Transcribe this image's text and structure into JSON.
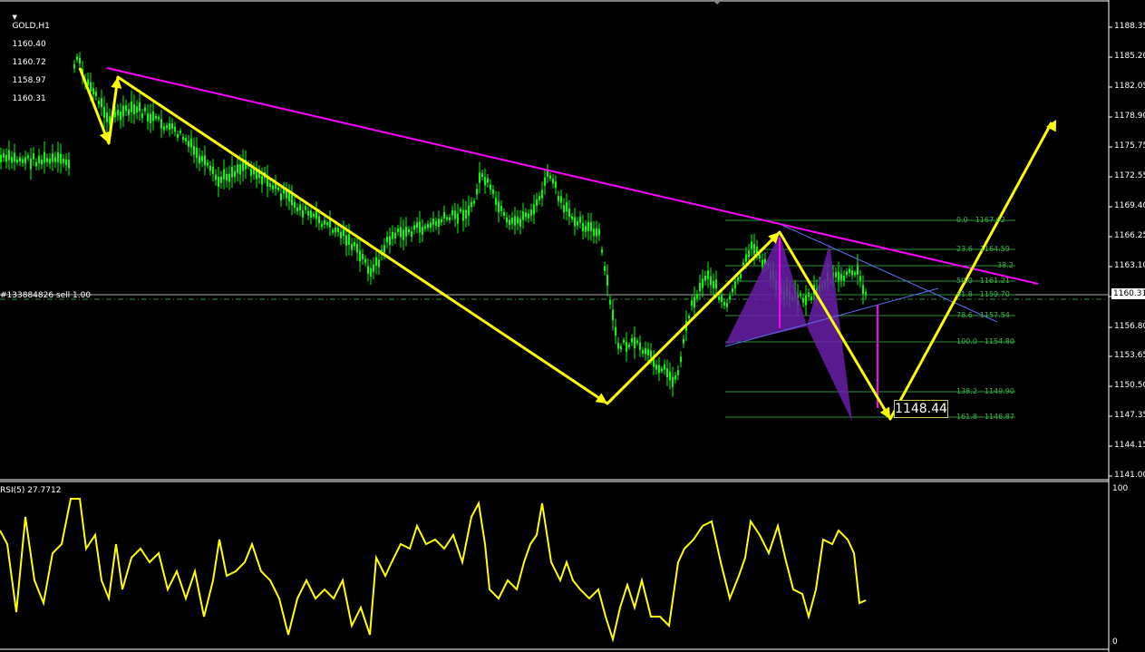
{
  "header": {
    "symbol": "GOLD,H1",
    "open": "1160.40",
    "high": "1160.72",
    "low": "1158.97",
    "close": "1160.31"
  },
  "order_line_label": "#133884826 sell 1.00",
  "current_price": "1160.31",
  "target_label": "1148.44",
  "price_axis": [
    "1188.35",
    "1185.20",
    "1182.05",
    "1178.90",
    "1175.75",
    "1172.55",
    "1169.40",
    "1166.25",
    "1163.10",
    "1159.95",
    "1156.80",
    "1153.65",
    "1150.50",
    "1147.35",
    "1144.15",
    "1141.00"
  ],
  "fib_levels": [
    {
      "label": "0.0 - 1167.62"
    },
    {
      "label": "23.6 - 1164.59"
    },
    {
      "label": "38.2"
    },
    {
      "label": "50.0 - 1161.21"
    },
    {
      "label": "61.8 - 1159.70"
    },
    {
      "label": "78.6 - 1157.54"
    },
    {
      "label": "100.0 - 1154.80"
    },
    {
      "label": "138.2 - 1149.90"
    },
    {
      "label": "161.8 - 1146.87"
    }
  ],
  "rsi": {
    "label": "RSI(5) 27.7712",
    "axis_top": "100",
    "axis_bottom": "0"
  },
  "colors": {
    "bull_candle": "#00ff00",
    "trendline": "#ff00ff",
    "pattern": "#ffff00",
    "fib": "#2d8f3a",
    "harmonic_fill": "#6a1fa8",
    "channel": "#5a6ff0",
    "rsi_line": "#ffff00"
  }
}
